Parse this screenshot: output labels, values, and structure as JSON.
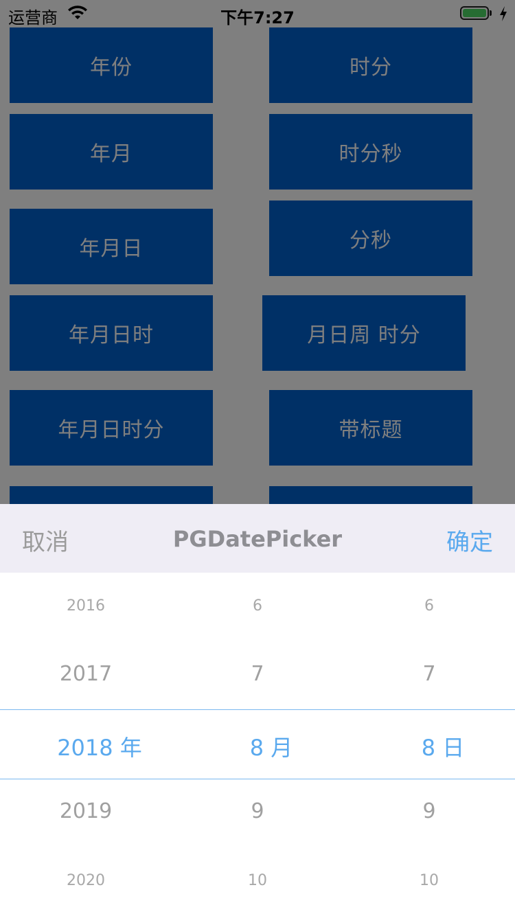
{
  "status_bar": {
    "carrier": "运营商",
    "time": "下午7:27"
  },
  "buttons": {
    "year": "年份",
    "hour_minute": "时分",
    "year_month": "年月",
    "hour_minute_second": "时分秒",
    "year_month_day": "年月日",
    "minute_second": "分秒",
    "year_month_day_hour": "年月日时",
    "month_day_week_hour_minute": "月日周 时分",
    "year_month_day_hour_minute": "年月日时分",
    "with_title": "带标题"
  },
  "picker": {
    "cancel_label": "取消",
    "title": "PGDatePicker",
    "confirm_label": "确定",
    "year_column": {
      "rows": [
        "2016",
        "2017",
        "2018 年",
        "2019",
        "2020"
      ],
      "selected": "2018 年"
    },
    "month_column": {
      "rows": [
        "6",
        "7",
        "8 月",
        "9",
        "10"
      ],
      "selected": "8 月"
    },
    "day_column": {
      "rows": [
        "6",
        "7",
        "8 日",
        "9",
        "10"
      ],
      "selected": "8 日"
    }
  },
  "colors": {
    "button_blue": "#0060cc",
    "accent": "#5aa9ee",
    "toolbar_bg": "#efedf5",
    "overlay": "rgba(0,0,0,0.5)"
  }
}
